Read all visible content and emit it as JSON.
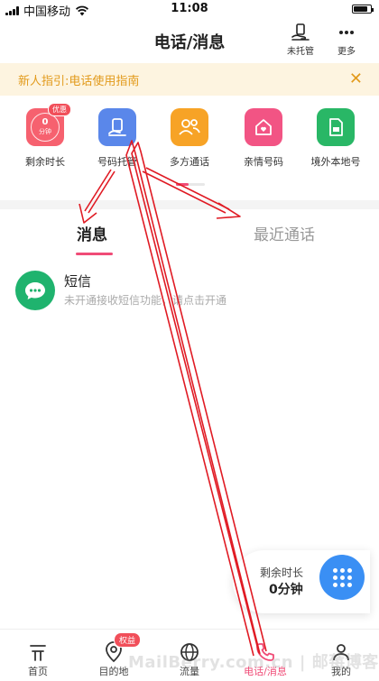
{
  "status_bar": {
    "carrier": "中国移动",
    "time": "11:08"
  },
  "header": {
    "title": "电话/消息",
    "untrust_label": "未托管",
    "more_label": "更多"
  },
  "guide_banner": {
    "text": "新人指引:电话使用指南",
    "close_symbol": "✕"
  },
  "quick_actions": [
    {
      "label": "剩余时长",
      "icon": "clock-icon",
      "color": "#f6616f",
      "badge": "优惠",
      "remaining_value": "0",
      "remaining_unit": "分钟"
    },
    {
      "label": "号码托管",
      "icon": "phone-hosting-icon",
      "color": "#5a87ea"
    },
    {
      "label": "多方通话",
      "icon": "group-call-icon",
      "color": "#f7a326"
    },
    {
      "label": "亲情号码",
      "icon": "family-heart-icon",
      "color": "#f25484"
    },
    {
      "label": "境外本地号",
      "icon": "sim-card-icon",
      "color": "#29b766"
    }
  ],
  "tabs": {
    "messages": "消息",
    "recent_calls": "最近通话"
  },
  "sms_item": {
    "title": "短信",
    "description": "未开通接收短信功能，请点击开通"
  },
  "floating_card": {
    "label": "剩余时长",
    "value": "0分钟"
  },
  "tabbar": [
    {
      "label": "首页",
      "icon": "home-icon"
    },
    {
      "label": "目的地",
      "icon": "location-pin-icon",
      "badge": "权益"
    },
    {
      "label": "流量",
      "icon": "globe-icon"
    },
    {
      "label": "电话/消息",
      "icon": "phone-icon",
      "active": true
    },
    {
      "label": "我的",
      "icon": "user-icon"
    }
  ],
  "watermark": "MailBerry.com.cn | 邮莓博客",
  "colors": {
    "accent": "#f04c77",
    "banner_text": "#e29a1b",
    "banner_bg": "#fdf4e0",
    "annotation_red": "#e01b24",
    "dialpad_blue": "#3a8ff4"
  }
}
